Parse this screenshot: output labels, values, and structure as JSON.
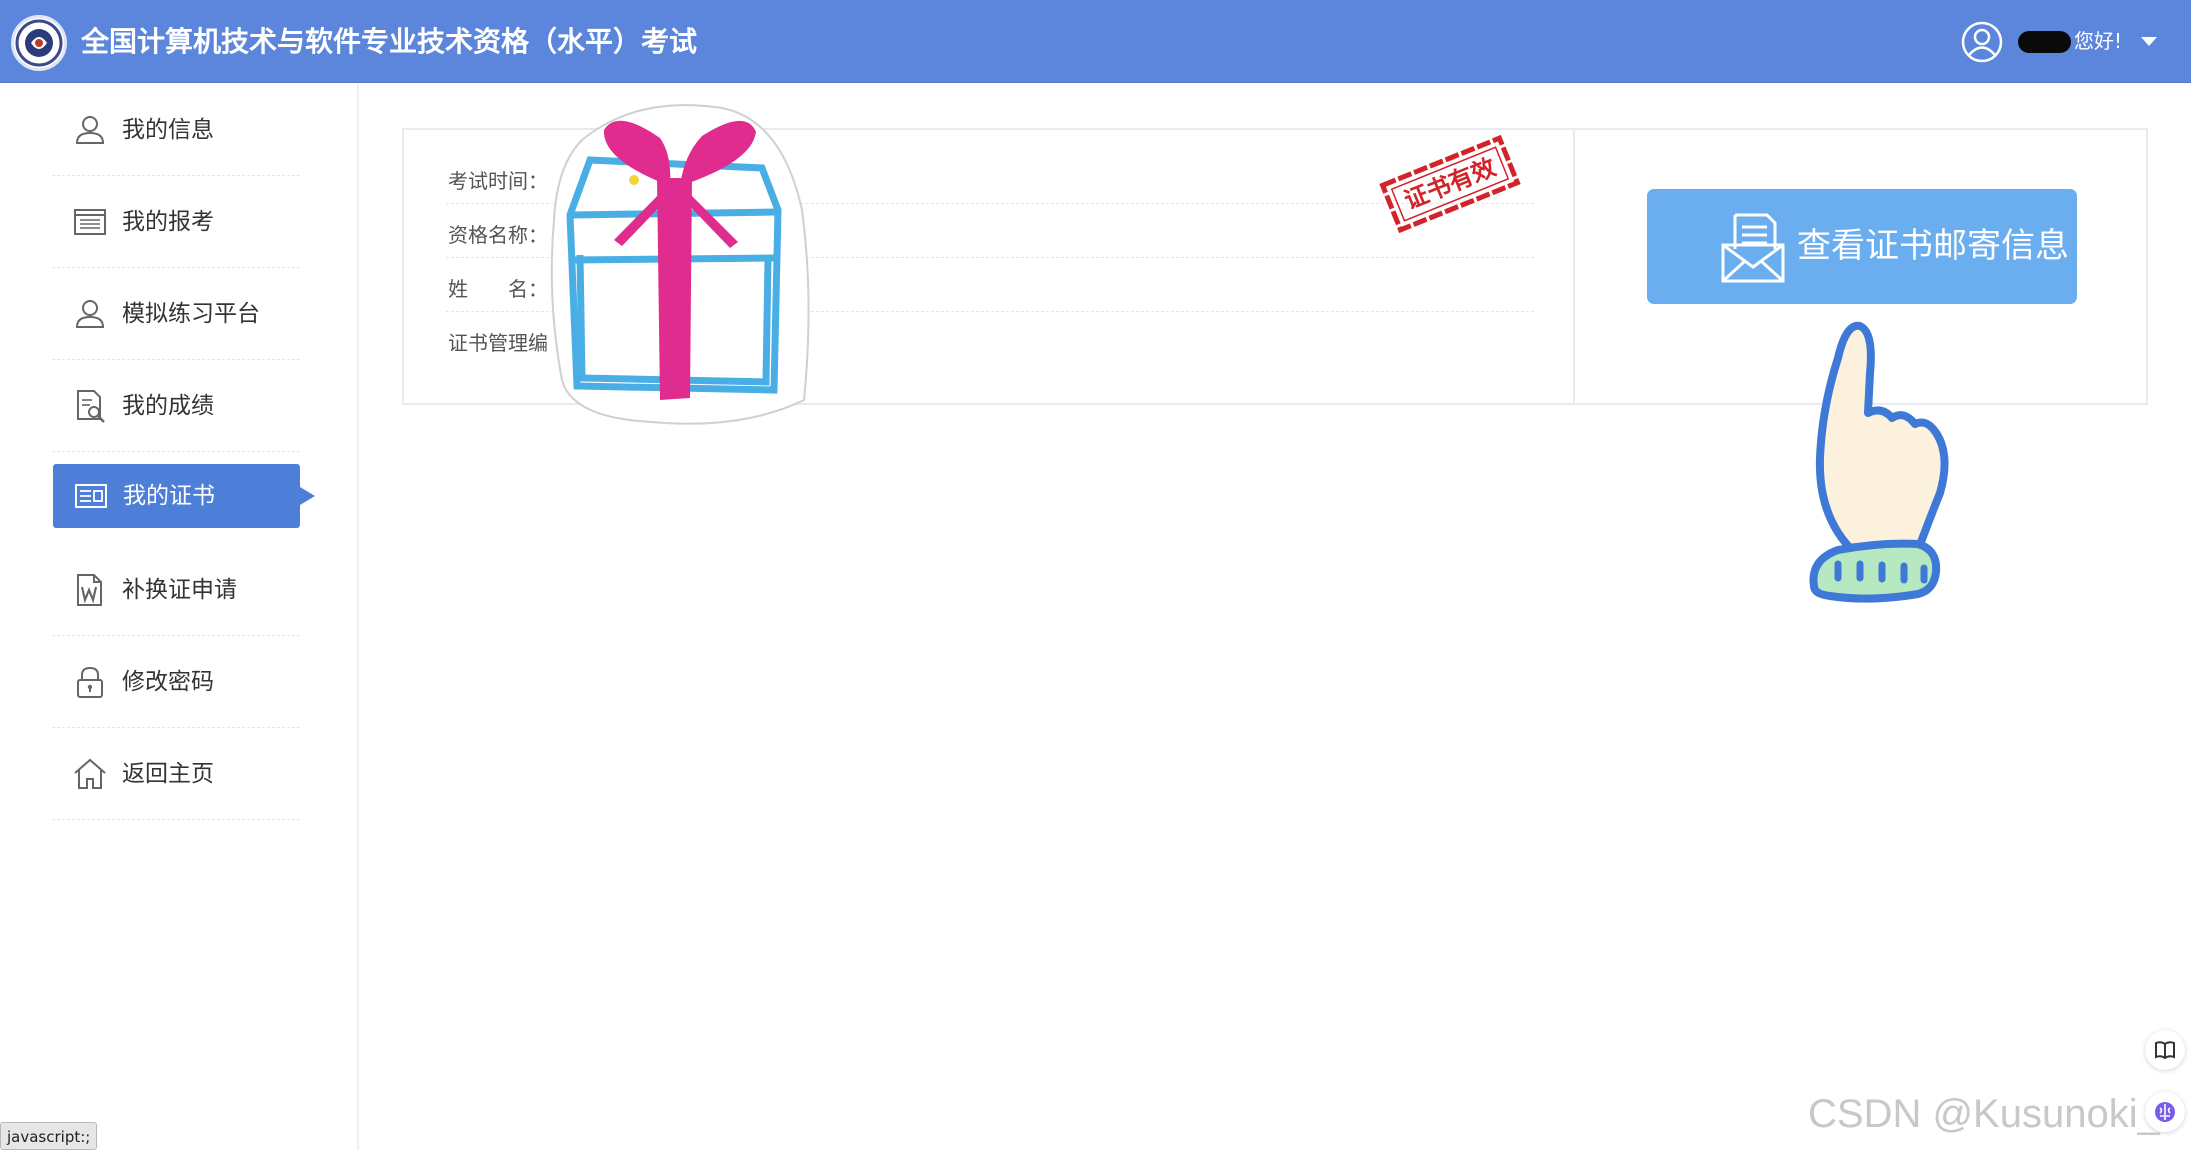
{
  "header": {
    "title": "全国计算机技术与软件专业技术资格（水平）考试",
    "greeting": "您好!",
    "bar_color": "#5b86dc"
  },
  "sidebar": {
    "items": [
      {
        "label": "我的信息",
        "icon": "user-icon",
        "active": false
      },
      {
        "label": "我的报考",
        "icon": "list-icon",
        "active": false
      },
      {
        "label": "模拟练习平台",
        "icon": "user-icon",
        "active": false
      },
      {
        "label": "我的成绩",
        "icon": "document-search-icon",
        "active": false
      },
      {
        "label": "我的证书",
        "icon": "certificate-icon",
        "active": true
      },
      {
        "label": "补换证申请",
        "icon": "word-document-icon",
        "active": false
      },
      {
        "label": "修改密码",
        "icon": "lock-icon",
        "active": false
      },
      {
        "label": "返回主页",
        "icon": "home-icon",
        "active": false
      }
    ],
    "active_color": "#4d7fd8"
  },
  "certificate": {
    "fields": [
      {
        "label": "考试时间："
      },
      {
        "label": "资格名称："
      },
      {
        "label": "姓　　名："
      },
      {
        "label": "证书管理编"
      }
    ],
    "stamp_text": "证书有效",
    "mail_button_label": "查看证书邮寄信息"
  },
  "status_bar": {
    "link": "javascript:;"
  },
  "watermark": "CSDN @Kusunoki_"
}
